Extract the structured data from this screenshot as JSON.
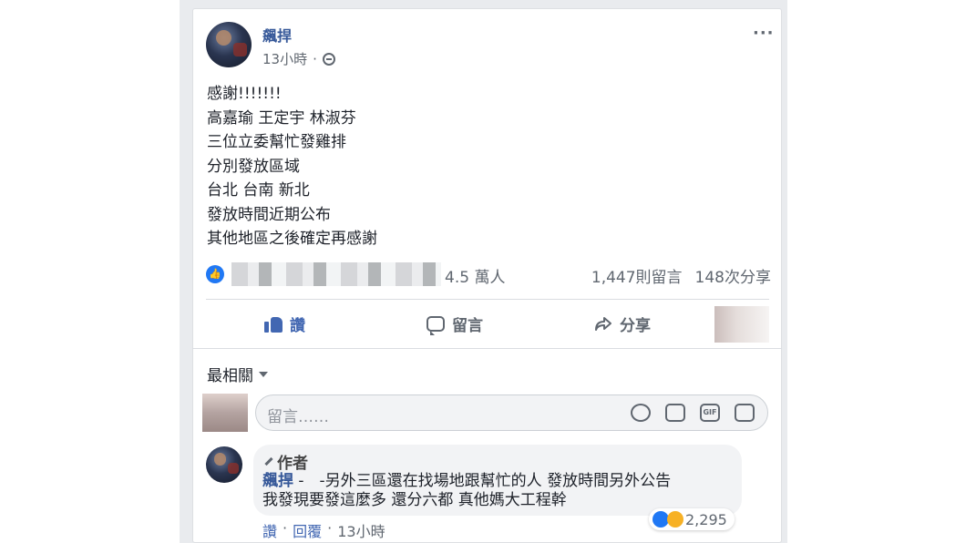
{
  "post": {
    "author": "飆捍",
    "time": "13小時",
    "more_icon": "···",
    "lines": [
      "感謝!!!!!!!",
      "高嘉瑜 王定宇 林淑芬",
      "三位立委幫忙發雞排",
      "分別發放區域",
      "台北 台南 新北",
      "發放時間近期公布",
      "其他地區之後確定再感謝"
    ]
  },
  "stats": {
    "likes": "4.5 萬人",
    "comments": "1,447則留言",
    "shares": "148次分享"
  },
  "actions": {
    "like": "讚",
    "comment": "留言",
    "share": "分享"
  },
  "sort": {
    "label": "最相關"
  },
  "composer": {
    "placeholder": "留言……"
  },
  "comment": {
    "author_badge": "作者",
    "name": "飆捍",
    "text_line1": " -　-另外三區還在找場地跟幫忙的人 發放時間另外公告",
    "text_line2": "我發現要發這麼多 還分六都 真他媽大工程幹",
    "like": "讚",
    "reply": "回覆",
    "time": "13小時",
    "reaction_count": "2,295"
  },
  "colors": {
    "link": "#365899",
    "accent": "#4267b2",
    "like_blue": "#2078f4",
    "muted": "#606770"
  }
}
